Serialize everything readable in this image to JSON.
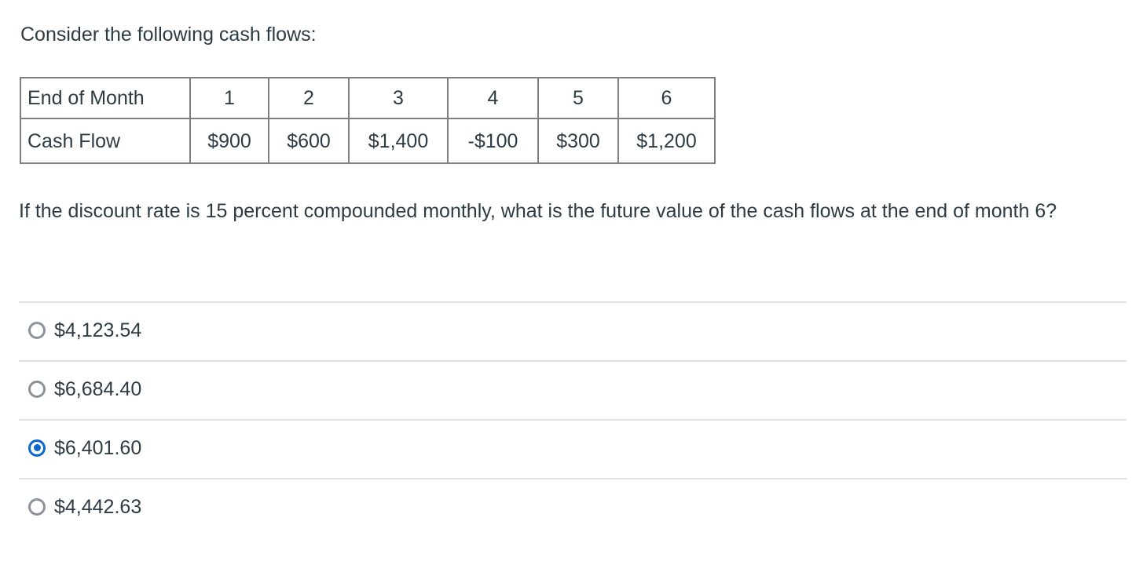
{
  "intro": {
    "text": "Consider the following cash flows:"
  },
  "cash_flow_table": {
    "row_labels": [
      "End of Month",
      "Cash Flow"
    ],
    "months": [
      "1",
      "2",
      "3",
      "4",
      "5",
      "6"
    ],
    "cash_flows": [
      "$900",
      "$600",
      "$1,400",
      "-$100",
      "$300",
      "$1,200"
    ]
  },
  "question": {
    "text": "If the discount rate is 15 percent compounded monthly, what is the future value of the cash flows at the end of month 6?"
  },
  "answers": {
    "options": [
      {
        "label": "$4,123.54",
        "selected": false
      },
      {
        "label": "$6,684.40",
        "selected": false
      },
      {
        "label": "$6,401.60",
        "selected": true
      },
      {
        "label": "$4,442.63",
        "selected": false
      }
    ]
  },
  "colors": {
    "text": "#2d3b45",
    "table_border": "#808080",
    "divider": "#e2e2e2",
    "radio_unselected": "#8b929a",
    "radio_selected": "#0b67d0",
    "background": "#ffffff"
  }
}
